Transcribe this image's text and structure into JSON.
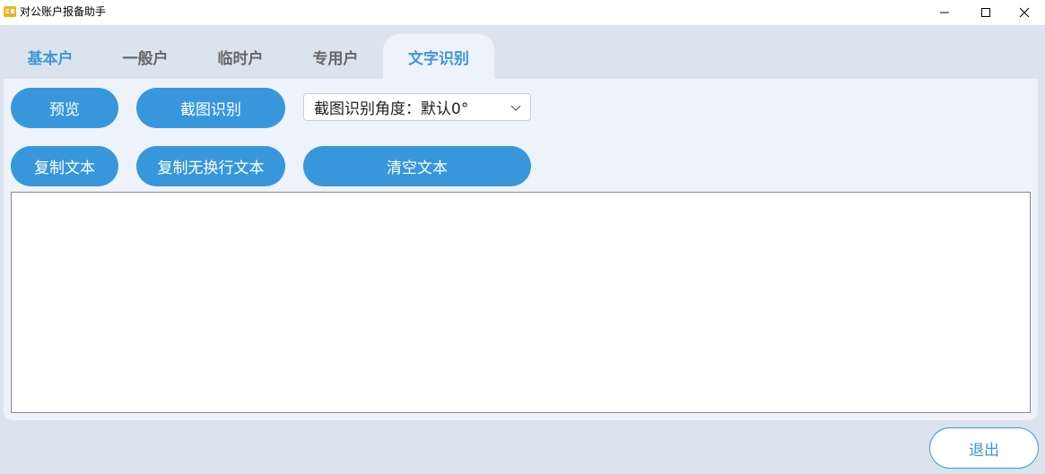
{
  "window": {
    "title": "对公账户报备助手",
    "icon": "app-logo-icon",
    "controls": [
      "minimize-icon",
      "maximize-icon",
      "close-icon"
    ]
  },
  "tabs": [
    {
      "label": "基本户",
      "active": false
    },
    {
      "label": "一般户",
      "active": false
    },
    {
      "label": "临时户",
      "active": false
    },
    {
      "label": "专用户",
      "active": false
    },
    {
      "label": "文字识别",
      "active": true
    }
  ],
  "toolbar": {
    "preview_label": "预览",
    "capture_label": "截图识别",
    "angle_select_value": "截图识别角度：默认0°",
    "copy_label": "复制文本",
    "copy_nobreak_label": "复制无换行文本",
    "clear_label": "清空文本"
  },
  "text_area": {
    "value": ""
  },
  "footer": {
    "exit_label": "退出"
  },
  "colors": {
    "accent": "#3897db",
    "tab_active_text": "#3f97d9",
    "panel_bg": "#eef2fa",
    "window_bg": "#dbe4ee"
  }
}
